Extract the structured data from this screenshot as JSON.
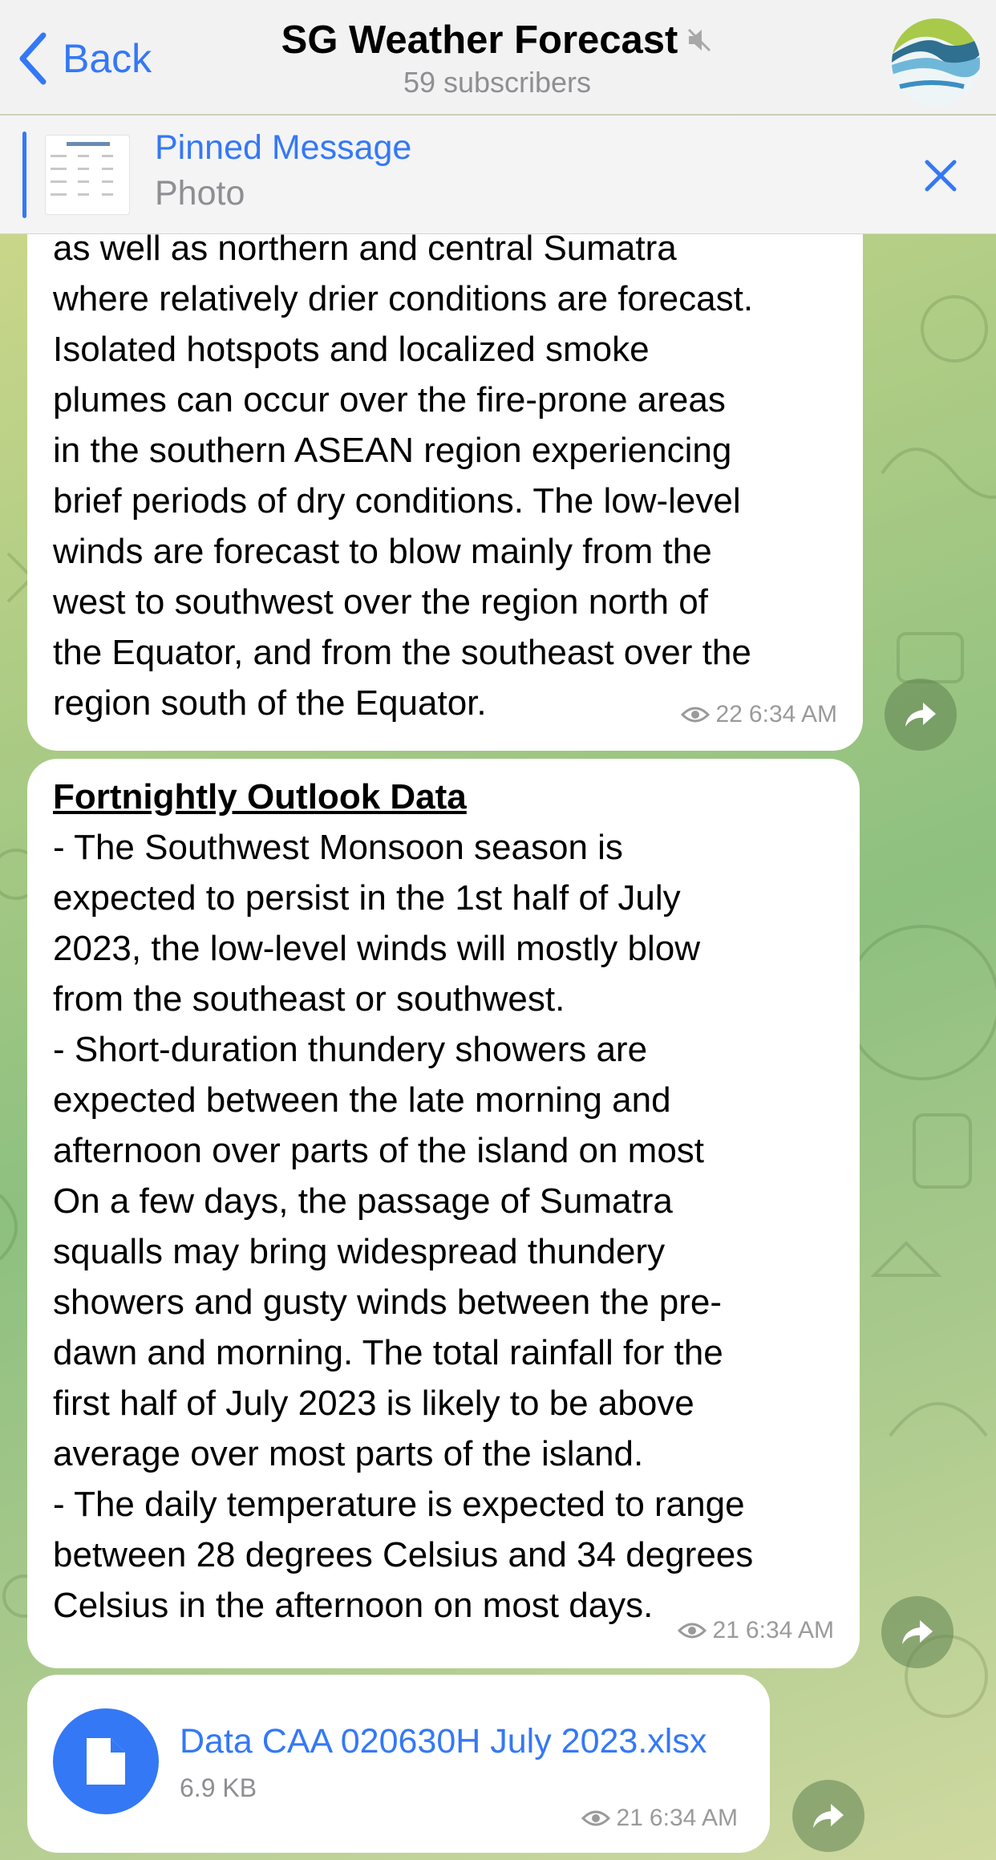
{
  "header": {
    "back_label": "Back",
    "title": "SG Weather Forecast",
    "subtitle": "59 subscribers"
  },
  "pinned": {
    "title": "Pinned Message",
    "subtitle": "Photo"
  },
  "messages": [
    {
      "lines": [
        "as well as northern and central Sumatra",
        "where relatively drier conditions are forecast.",
        "Isolated hotspots and localized smoke",
        "plumes can occur over the fire-prone areas",
        "in the southern ASEAN region experiencing",
        "brief periods of dry conditions. The low-level",
        "winds are forecast to blow mainly from the",
        "west to southwest over the region north of",
        "the Equator, and from the southeast over the",
        "region south of the Equator."
      ],
      "views": "22",
      "time": "6:34 AM"
    },
    {
      "heading": "Fortnightly Outlook Data",
      "lines": [
        "- The Southwest Monsoon season is",
        "expected to persist in the 1st half of July",
        "2023, the low-level winds will mostly blow",
        "from the southeast or southwest.",
        "- Short-duration thundery showers are",
        "expected between the late morning and",
        "afternoon over parts of the island on most",
        "On a few days, the passage of Sumatra",
        "squalls may bring widespread thundery",
        "showers and gusty winds between the pre-",
        "dawn and morning. The total rainfall for the",
        "first half of July 2023 is likely to be above",
        "average over most parts of the island.",
        "- The daily temperature is expected to range",
        "between 28 degrees Celsius and 34 degrees",
        "Celsius in the afternoon on most days."
      ],
      "views": "21",
      "time": "6:34 AM"
    },
    {
      "file_name": "Data CAA 020630H July 2023.xlsx",
      "file_size": "6.9 KB",
      "views": "21",
      "time": "6:34 AM"
    }
  ],
  "colors": {
    "accent": "#3478f6",
    "bubble": "#ffffff",
    "meta_text": "#9a9a9a"
  },
  "icons": [
    "chevron-left-icon",
    "mute-icon",
    "channel-avatar",
    "close-icon",
    "eye-icon",
    "share-icon",
    "document-icon"
  ]
}
